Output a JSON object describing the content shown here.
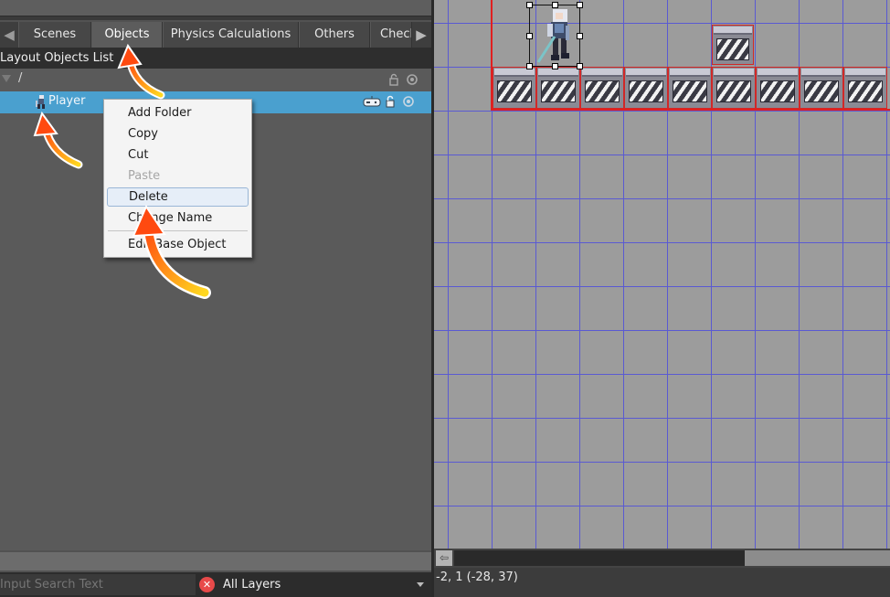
{
  "tabs": {
    "items": [
      {
        "label": "Scenes"
      },
      {
        "label": "Objects"
      },
      {
        "label": "Physics Calculations"
      },
      {
        "label": "Others"
      },
      {
        "label": "Check"
      }
    ],
    "active": "Objects"
  },
  "panel": {
    "title": "Layout Objects List",
    "root_path": "/",
    "object_name": "Player"
  },
  "context_menu": {
    "items": [
      {
        "label": "Add Folder",
        "enabled": true
      },
      {
        "label": "Copy",
        "enabled": true
      },
      {
        "label": "Cut",
        "enabled": true
      },
      {
        "label": "Paste",
        "enabled": false
      },
      {
        "label": "Delete",
        "enabled": true,
        "highlighted": true
      },
      {
        "label": "Change Name",
        "enabled": true
      },
      {
        "label": "Edit Base Object",
        "enabled": true
      }
    ]
  },
  "search": {
    "placeholder": "Input Search Text",
    "layer_filter": "All Layers"
  },
  "status": {
    "coords": "-2, 1 (-28, 37)"
  },
  "colors": {
    "selection": "#4aa0cf",
    "grid_line": "#5a5ad2",
    "room_bound": "#e02020",
    "annotation_arrow": "#ff7a10"
  },
  "icons": {
    "tab_prev": "arrow-left-icon",
    "tab_next": "arrow-right-icon",
    "clear_search": "clear-icon"
  }
}
